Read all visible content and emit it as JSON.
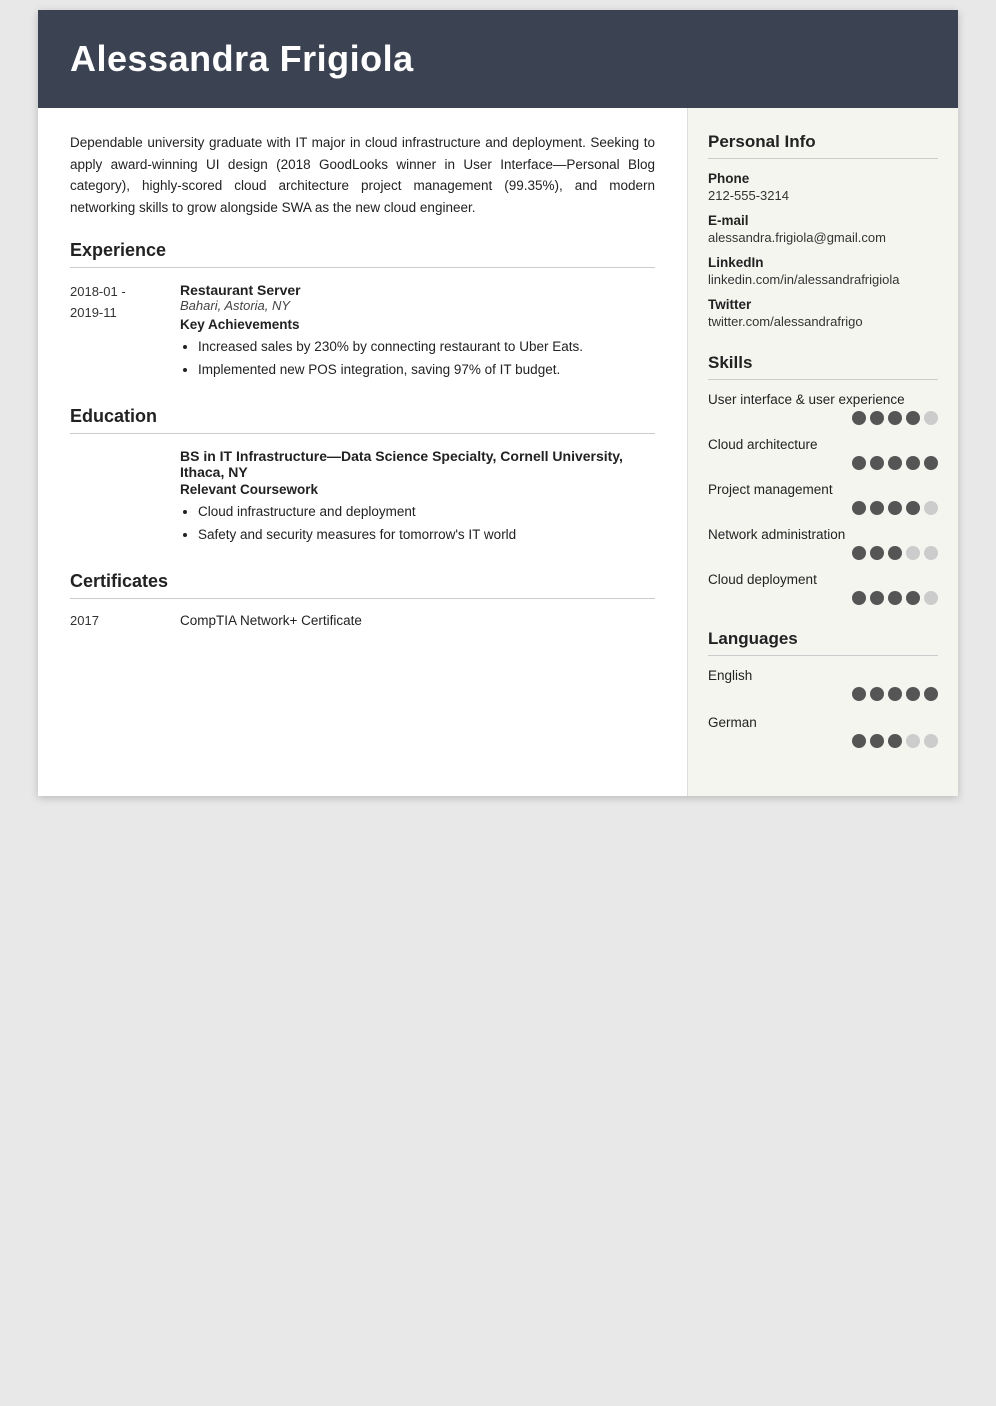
{
  "header": {
    "name": "Alessandra Frigiola"
  },
  "summary": {
    "text": "Dependable university graduate with IT major in cloud infrastructure and deployment. Seeking to apply award-winning UI design (2018 GoodLooks winner in User Interface—Personal Blog category), highly-scored cloud architecture project management (99.35%), and modern networking skills to grow alongside SWA as the new cloud engineer."
  },
  "sections": {
    "experience_label": "Experience",
    "education_label": "Education",
    "certificates_label": "Certificates"
  },
  "experience": [
    {
      "date_start": "2018-01 -",
      "date_end": "2019-11",
      "job_title": "Restaurant Server",
      "location": "Bahari, Astoria, NY",
      "achievements_label": "Key Achievements",
      "bullets": [
        "Increased sales by 230% by connecting restaurant to Uber Eats.",
        "Implemented new POS integration, saving 97% of IT budget."
      ]
    }
  ],
  "education": [
    {
      "degree": "BS in IT Infrastructure—Data Science Specialty, Cornell University, Ithaca, NY",
      "coursework_label": "Relevant Coursework",
      "bullets": [
        "Cloud infrastructure and deployment",
        "Safety and security measures for tomorrow's IT world"
      ]
    }
  ],
  "certificates": [
    {
      "year": "2017",
      "name": "CompTIA Network+ Certificate"
    }
  ],
  "personal_info": {
    "section_label": "Personal Info",
    "phone_label": "Phone",
    "phone": "212-555-3214",
    "email_label": "E-mail",
    "email": "alessandra.frigiola@gmail.com",
    "linkedin_label": "LinkedIn",
    "linkedin": "linkedin.com/in/alessandrafrigiola",
    "twitter_label": "Twitter",
    "twitter": "twitter.com/alessandrafrigo"
  },
  "skills": {
    "section_label": "Skills",
    "items": [
      {
        "name": "User interface & user experience",
        "filled": 4,
        "total": 5
      },
      {
        "name": "Cloud architecture",
        "filled": 5,
        "total": 5
      },
      {
        "name": "Project management",
        "filled": 4,
        "total": 5
      },
      {
        "name": "Network administration",
        "filled": 3,
        "total": 5
      },
      {
        "name": "Cloud deployment",
        "filled": 4,
        "total": 5
      }
    ]
  },
  "languages": {
    "section_label": "Languages",
    "items": [
      {
        "name": "English",
        "filled": 5,
        "total": 5
      },
      {
        "name": "German",
        "filled": 3,
        "total": 5
      }
    ]
  }
}
